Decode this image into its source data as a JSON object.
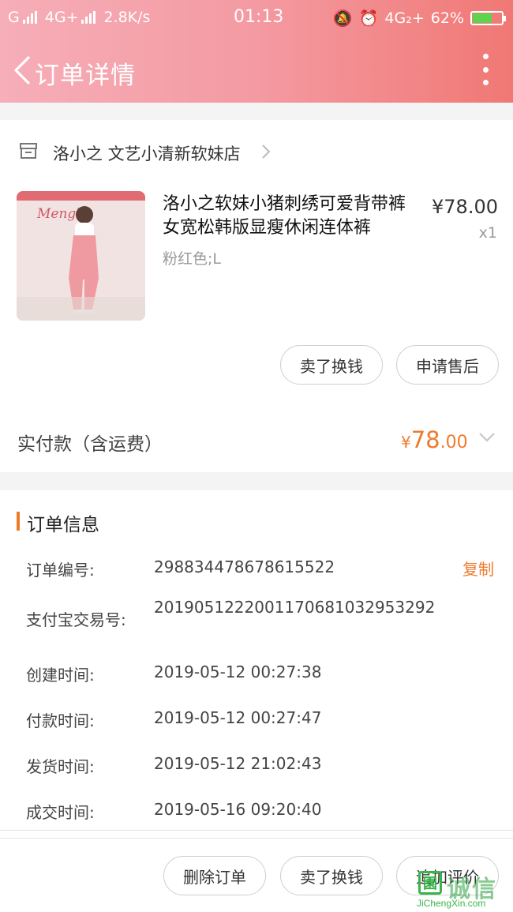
{
  "status_bar": {
    "carrier": "G",
    "network1": "4G+",
    "speed": "2.8K/s",
    "time": "01:13",
    "network2": "4G₂+",
    "battery": "62%"
  },
  "nav": {
    "title": "订单详情"
  },
  "shop": {
    "name": "洛小之 文艺小清新软妹店"
  },
  "product": {
    "title": "洛小之软妹小猪刺绣可爱背带裤女宽松韩版显瘦休闲连体裤",
    "sku": "粉红色;L",
    "price": "¥78.00",
    "qty": "x1"
  },
  "item_actions": {
    "sell_label": "卖了换钱",
    "after_sale_label": "申请售后"
  },
  "payment": {
    "label": "实付款（含运费）",
    "currency": "¥",
    "amount_int": "78",
    "amount_dec": ".00",
    "accent_color": "#ef7a2c"
  },
  "order_info": {
    "title": "订单信息",
    "copy_label": "复制",
    "rows": [
      {
        "label": "订单编号:",
        "value": "298834478678615522"
      },
      {
        "label": "支付宝交易号:",
        "value": "2019051222001170681032953292"
      },
      {
        "label": "创建时间:",
        "value": "2019-05-12 00:27:38"
      },
      {
        "label": "付款时间:",
        "value": "2019-05-12 00:27:47"
      },
      {
        "label": "发货时间:",
        "value": "2019-05-12 21:02:43"
      },
      {
        "label": "成交时间:",
        "value": "2019-05-16 09:20:40"
      }
    ]
  },
  "bottom_actions": {
    "delete_label": "删除订单",
    "sell_label": "卖了换钱",
    "review_label": "追加评价"
  },
  "watermark": {
    "text": "诚信",
    "site": "JiChengXin.com"
  }
}
